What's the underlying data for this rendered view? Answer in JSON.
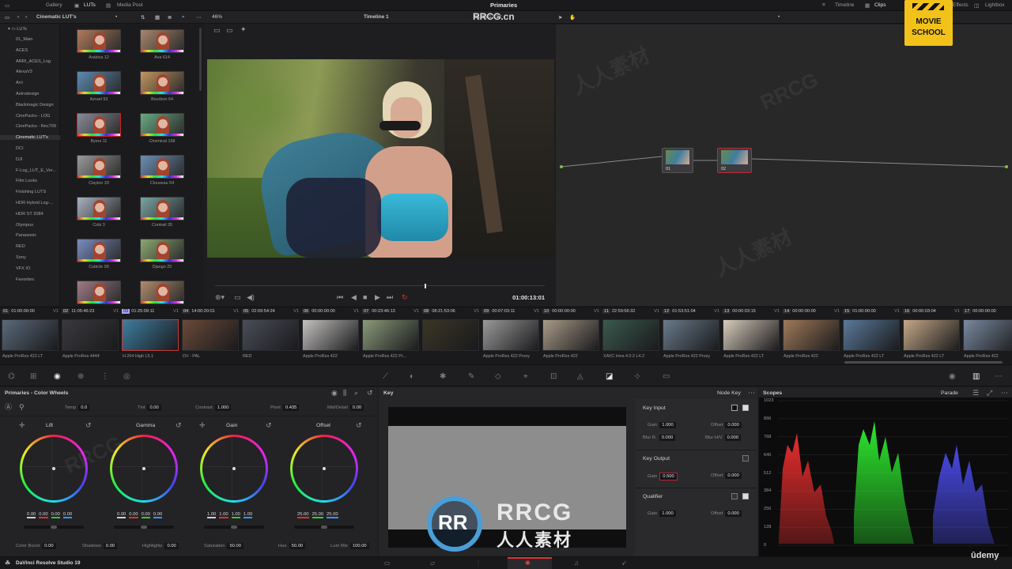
{
  "app": {
    "title": "Primaries",
    "watermark_top": "RRCG.cn",
    "version_label": "DaVinci Resolve Studio 19"
  },
  "topbar": {
    "left_tabs": [
      "Gallery",
      "LUTs",
      "Media Pool"
    ],
    "right_tabs": [
      "Timeline",
      "Clips",
      "Effects",
      "Lightbox"
    ]
  },
  "subbar": {
    "lut_folder": "Cinematic LUT's",
    "zoom": "46%",
    "timeline_name": "Timeline 1",
    "source_timecode": "01:25:12:12"
  },
  "lut_tree": {
    "root": "LUTs",
    "items": [
      "01_Main",
      "ACES",
      "ARRI_ACES_Log",
      "AlexaV3",
      "Arri",
      "Astrodesign",
      "Blackmagic Design",
      "CinePacks - LOG",
      "CinePacks - Rec709",
      "Cinematic LUT's",
      "DCI",
      "DJI",
      "F-Log_LUT_E_Ver...",
      "Film Looks",
      "Finishing LUTS",
      "HDR Hybrid Log-...",
      "HDR ST 2084",
      "Olympus",
      "Panasonic",
      "RED",
      "Sony",
      "VFX IO",
      "Favorites"
    ],
    "selected": "Cinematic LUT's"
  },
  "luts": [
    {
      "name": "Arabica 12",
      "tint": "#b07a5c"
    },
    {
      "name": "Ava 614",
      "tint": "#a8866c"
    },
    {
      "name": "Azrael 93",
      "tint": "#5c8ab0"
    },
    {
      "name": "Bourbon 64",
      "tint": "#c29460"
    },
    {
      "name": "Byers 11",
      "tint": "#8a8a9a"
    },
    {
      "name": "Chemical 168",
      "tint": "#6aa882"
    },
    {
      "name": "Clayton 33",
      "tint": "#9a9a9a"
    },
    {
      "name": "Clouseau 54",
      "tint": "#6c8eb4"
    },
    {
      "name": "Cobi 3",
      "tint": "#a9b1c0"
    },
    {
      "name": "Contrail 35",
      "tint": "#7aa4a4"
    },
    {
      "name": "Cubicle 99",
      "tint": "#7a8cc0"
    },
    {
      "name": "Django 25",
      "tint": "#8aa870"
    },
    {
      "name": "",
      "tint": "#a07a86"
    },
    {
      "name": "",
      "tint": "#b08a6c"
    }
  ],
  "viewer": {
    "timecode": "01:00:13:01"
  },
  "nodes": [
    {
      "label": "01"
    },
    {
      "label": "02"
    }
  ],
  "clips": [
    {
      "num": "01",
      "tc": "01:00:00:00",
      "track": "V1",
      "codec": "Apple ProRes 422 LT",
      "color": "#5a6a7a"
    },
    {
      "num": "02",
      "tc": "11:05:46:23",
      "track": "V1",
      "codec": "Apple ProRes 4444",
      "color": "#3a3a3e"
    },
    {
      "num": "03",
      "tc": "01:25:09:11",
      "track": "V1",
      "codec": "H.264 High L5.1",
      "color": "#3e7ea0",
      "selected": true
    },
    {
      "num": "04",
      "tc": "14:00:20:01",
      "track": "V1",
      "codec": "DV - PAL",
      "color": "#6a4a3a"
    },
    {
      "num": "05",
      "tc": "02:09:54:24",
      "track": "V1",
      "codec": "RED",
      "color": "#4a4e58"
    },
    {
      "num": "06",
      "tc": "00:00:00:00",
      "track": "V1",
      "codec": "Apple ProRes 422",
      "color": "#c4c2c0"
    },
    {
      "num": "07",
      "tc": "00:23:46:13",
      "track": "V1",
      "codec": "Apple ProRes 422 Pr...",
      "color": "#8a9a7a"
    },
    {
      "num": "08",
      "tc": "08:21:53:06",
      "track": "V1",
      "codec": "",
      "color": "#3a3626"
    },
    {
      "num": "09",
      "tc": "00:07:03:11",
      "track": "V1",
      "codec": "Apple ProRes 422 Proxy",
      "color": "#9a9a9a"
    },
    {
      "num": "10",
      "tc": "00:00:00:00",
      "track": "V1",
      "codec": "Apple ProRes 422",
      "color": "#a89a88"
    },
    {
      "num": "11",
      "tc": "22:59:56:32",
      "track": "V1",
      "codec": "XAVC Intra 4:2:2 L4.2",
      "color": "#3a5a4e"
    },
    {
      "num": "12",
      "tc": "01:53:51:04",
      "track": "V1",
      "codec": "Apple ProRes 422 Proxy",
      "color": "#6a7a8a"
    },
    {
      "num": "13",
      "tc": "00:00:03:15",
      "track": "V1",
      "codec": "Apple ProRes 422 LT",
      "color": "#d8ccbc"
    },
    {
      "num": "14",
      "tc": "00:00:00:00",
      "track": "V1",
      "codec": "Apple ProRes 422",
      "color": "#a07a5a"
    },
    {
      "num": "15",
      "tc": "01:00:00:00",
      "track": "V1",
      "codec": "Apple ProRes 422 LT",
      "color": "#5a7a9a"
    },
    {
      "num": "16",
      "tc": "00:00:03:04",
      "track": "V1",
      "codec": "Apple ProRes 422 LT",
      "color": "#c4a888"
    },
    {
      "num": "17",
      "tc": "00:00:00:00",
      "track": "V1",
      "codec": "Apple ProRes 422",
      "color": "#7a8aa0"
    }
  ],
  "wheels_panel": {
    "title": "Primaries - Color Wheels",
    "params": {
      "temp_label": "Temp",
      "temp": "0.0",
      "tint_label": "Tint",
      "tint": "0.00",
      "contrast_label": "Contrast",
      "contrast": "1.000",
      "pivot_label": "Pivot",
      "pivot": "0.435",
      "middetail_label": "Mid/Detail",
      "middetail": "0.00"
    },
    "wheels": [
      {
        "name": "Lift",
        "values": [
          "0.00",
          "0.00",
          "0.00",
          "0.00"
        ]
      },
      {
        "name": "Gamma",
        "values": [
          "0.00",
          "0.00",
          "0.00",
          "0.00"
        ]
      },
      {
        "name": "Gain",
        "values": [
          "1.00",
          "1.00",
          "1.00",
          "1.00"
        ]
      },
      {
        "name": "Offset",
        "values": [
          "25.00",
          "25.00",
          "25.00"
        ]
      }
    ],
    "bottom": {
      "colorboost_label": "Color Boost",
      "colorboost": "0.00",
      "shadows_label": "Shadows",
      "shadows": "0.00",
      "highlights_label": "Highlights",
      "highlights": "0.00",
      "saturation_label": "Saturation",
      "saturation": "50.00",
      "hue_label": "Hue",
      "hue": "50.00",
      "lummix_label": "Lum Mix",
      "lummix": "100.00"
    }
  },
  "key_panel": {
    "title": "Key",
    "mode": "Node Key",
    "key_input": {
      "title": "Key Input",
      "gain_label": "Gain",
      "gain": "1.000",
      "offset_label": "Offset",
      "offset": "0.000",
      "blurr_label": "Blur R.",
      "blurr": "0.000",
      "blurhv_label": "Blur H/V",
      "blurhv": "0.000"
    },
    "key_output": {
      "title": "Key Output",
      "gain_label": "Gain",
      "gain": "0.500",
      "offset_label": "Offset",
      "offset": "0.000"
    },
    "qualifier": {
      "title": "Qualifier",
      "gain_label": "Gain",
      "gain": "1.000",
      "offset_label": "Offset",
      "offset": "0.000"
    }
  },
  "scopes": {
    "title": "Scopes",
    "mode": "Parade",
    "scale": [
      "1023",
      "896",
      "768",
      "640",
      "512",
      "384",
      "256",
      "128",
      "0"
    ]
  },
  "overlays": {
    "logo_line1": "MOVIE",
    "logo_line2": "SCHOOL",
    "rrcg_top": "RRCG",
    "rrcg_bottom": "人人素材",
    "udemy": "ûdemy"
  }
}
